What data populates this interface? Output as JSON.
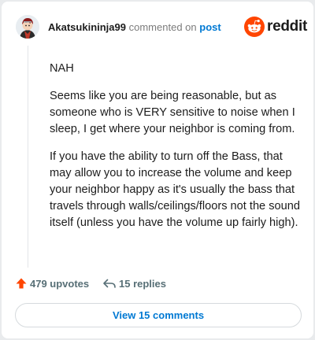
{
  "header": {
    "username": "Akatsukininja99",
    "action_text": "commented on",
    "link_text": "post",
    "brand_word": "reddit",
    "brand_color": "#ff4500"
  },
  "comment": {
    "paragraphs": [
      "NAH",
      "Seems like you are being reasonable, but as someone who is VERY sensitive to noise when I sleep, I get where your neighbor is coming from.",
      "If you have the ability to turn off the Bass, that may allow you to increase the volume and keep your neighbor happy as it's usually the bass that travels through walls/ceilings/floors not the sound itself (unless you have the volume up fairly high)."
    ]
  },
  "stats": {
    "upvotes_label": "479 upvotes",
    "replies_label": "15 replies",
    "upvote_icon": "arrow-up-icon",
    "reply_icon": "reply-arrow-icon"
  },
  "footer": {
    "view_comments_label": "View 15 comments"
  },
  "colors": {
    "accent": "#ff4500",
    "link": "#0079d3",
    "muted": "#576f76"
  }
}
